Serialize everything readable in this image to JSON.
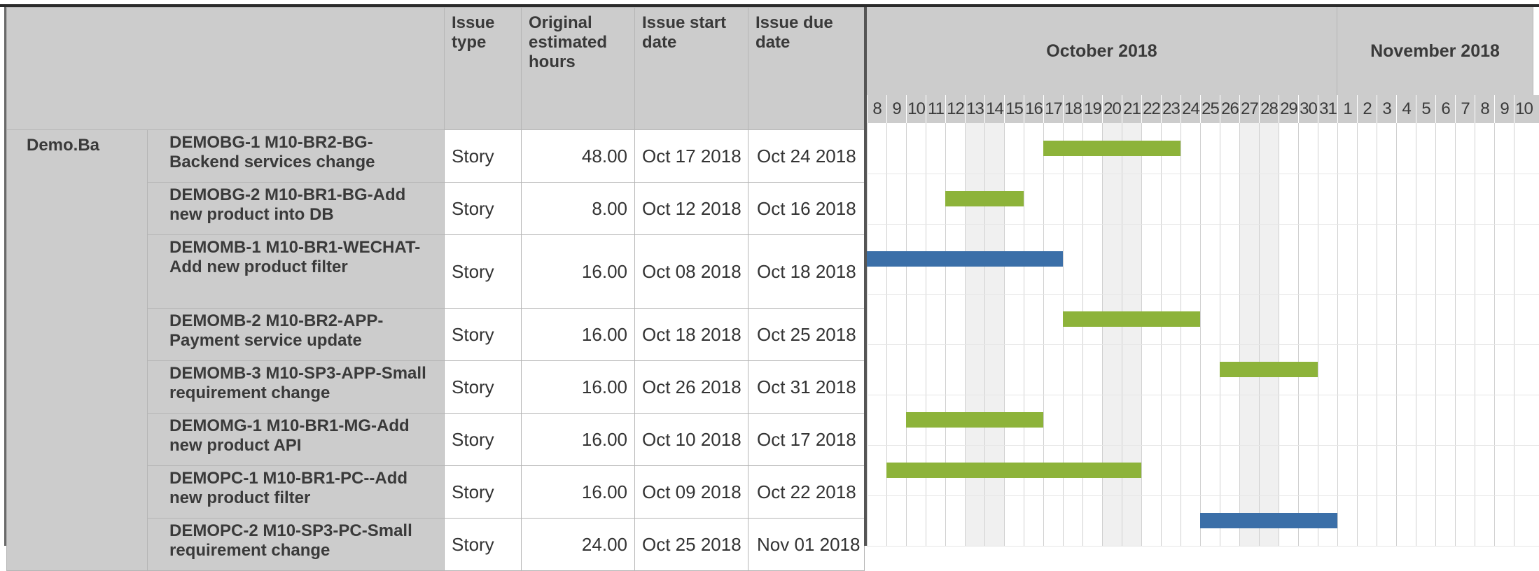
{
  "table": {
    "headers": {
      "issue_type": "Issue type",
      "original_estimate": "Original estimated hours",
      "start_date": "Issue start date",
      "due_date": "Issue due date"
    },
    "project": "Demo.Ba",
    "rows": [
      {
        "summary": "DEMOBG-1 M10-BR2-BG-Backend services change",
        "type": "Story",
        "hours": "48.00",
        "start": "Oct 17 2018",
        "due": "Oct 24 2018"
      },
      {
        "summary": "DEMOBG-2 M10-BR1-BG-Add new product into DB",
        "type": "Story",
        "hours": "8.00",
        "start": "Oct 12 2018",
        "due": "Oct 16 2018"
      },
      {
        "summary": "DEMOMB-1 M10-BR1-WECHAT-Add new product filter",
        "type": "Story",
        "hours": "16.00",
        "start": "Oct 08 2018",
        "due": "Oct 18 2018"
      },
      {
        "summary": "DEMOMB-2 M10-BR2-APP-Payment service update",
        "type": "Story",
        "hours": "16.00",
        "start": "Oct 18 2018",
        "due": "Oct 25 2018"
      },
      {
        "summary": "DEMOMB-3 M10-SP3-APP-Small requirement change",
        "type": "Story",
        "hours": "16.00",
        "start": "Oct 26 2018",
        "due": "Oct 31 2018"
      },
      {
        "summary": "DEMOMG-1 M10-BR1-MG-Add new product API",
        "type": "Story",
        "hours": "16.00",
        "start": "Oct 10 2018",
        "due": "Oct 17 2018"
      },
      {
        "summary": "DEMOPC-1 M10-BR1-PC--Add new product filter",
        "type": "Story",
        "hours": "16.00",
        "start": "Oct 09 2018",
        "due": "Oct 22 2018"
      },
      {
        "summary": "DEMOPC-2 M10-SP3-PC-Small requirement change",
        "type": "Story",
        "hours": "24.00",
        "start": "Oct 25 2018",
        "due": "Nov 01 2018"
      }
    ]
  },
  "gantt": {
    "months": [
      {
        "label": "October 2018",
        "start_index": 0,
        "days": 24
      },
      {
        "label": "November 2018",
        "start_index": 24,
        "days": 10
      }
    ],
    "days": [
      "8",
      "9",
      "10",
      "11",
      "12",
      "13",
      "14",
      "15",
      "16",
      "17",
      "18",
      "19",
      "20",
      "21",
      "22",
      "23",
      "24",
      "25",
      "26",
      "27",
      "28",
      "29",
      "30",
      "31",
      "1",
      "2",
      "3",
      "4",
      "5",
      "6",
      "7",
      "8",
      "9",
      "10"
    ],
    "weekend_indices": [
      5,
      6,
      12,
      13,
      19,
      20
    ],
    "colors": {
      "green": "#8db33a",
      "blue": "#3b6fa8"
    },
    "bars": [
      {
        "issue": "DEMOBG-1",
        "start_index": 9,
        "end_index": 16,
        "color": "#8db33a"
      },
      {
        "issue": "DEMOBG-2",
        "start_index": 4,
        "end_index": 8,
        "color": "#8db33a"
      },
      {
        "issue": "DEMOMB-1",
        "start_index": 0,
        "end_index": 10,
        "color": "#3b6fa8"
      },
      {
        "issue": "DEMOMB-2",
        "start_index": 10,
        "end_index": 17,
        "color": "#8db33a"
      },
      {
        "issue": "DEMOMB-3",
        "start_index": 18,
        "end_index": 23,
        "color": "#8db33a"
      },
      {
        "issue": "DEMOMG-1",
        "start_index": 2,
        "end_index": 9,
        "color": "#8db33a"
      },
      {
        "issue": "DEMOPC-1",
        "start_index": 1,
        "end_index": 14,
        "color": "#8db33a"
      },
      {
        "issue": "DEMOPC-2",
        "start_index": 17,
        "end_index": 24,
        "color": "#3b6fa8"
      }
    ]
  }
}
